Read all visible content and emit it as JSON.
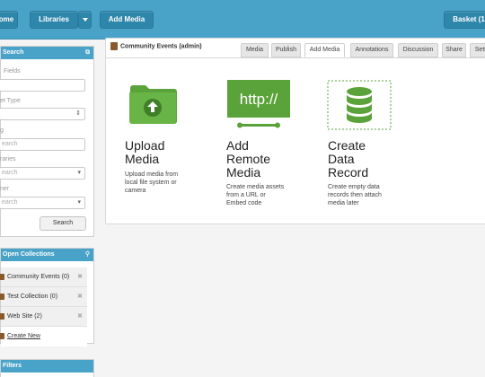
{
  "topbar": {
    "home_label": "ome",
    "libraries_label": "Libraries",
    "add_media_label": "Add Media",
    "basket_label": "Basket (1"
  },
  "search_panel": {
    "title": "Search",
    "fields_label": "Fields",
    "asset_type_label": "et Type",
    "tags_label": "g",
    "tags_placeholder": "earch",
    "libraries_label": "raries",
    "libraries_placeholder": "earch",
    "owner_label": "ner",
    "owner_placeholder": "earch",
    "search_button": "Search"
  },
  "collections_panel": {
    "title": "Open Collections",
    "items": [
      {
        "label": "Community Events (0)"
      },
      {
        "label": "Test Collection (0)"
      },
      {
        "label": "Web Site (2)"
      }
    ],
    "create_new": "Create New"
  },
  "filters_panel": {
    "title": "Filters"
  },
  "main": {
    "title": "Community Events (admin)",
    "tabs": [
      {
        "label": "Media"
      },
      {
        "label": "Publish"
      },
      {
        "label": "Add Media"
      },
      {
        "label": "Annotations"
      },
      {
        "label": "Discussion"
      },
      {
        "label": "Share"
      },
      {
        "label": "Sett"
      }
    ],
    "active_tab": "Add Media",
    "options": [
      {
        "title_lines": [
          "Upload",
          "Media"
        ],
        "desc_lines": [
          "Upload media from",
          "local file system or",
          "camera"
        ]
      },
      {
        "icon_text": "http://",
        "title_lines": [
          "Add",
          "Remote",
          "Media"
        ],
        "desc_lines": [
          "Create media assets",
          "from a URL or",
          "Embed code"
        ]
      },
      {
        "title_lines": [
          "Create",
          "Data",
          "Record"
        ],
        "desc_lines": [
          "Create empty data",
          "records then attach",
          "media later"
        ]
      }
    ]
  },
  "colors": {
    "accent": "#49a3c9",
    "button": "#2f86ab",
    "green": "#5aa33a"
  }
}
